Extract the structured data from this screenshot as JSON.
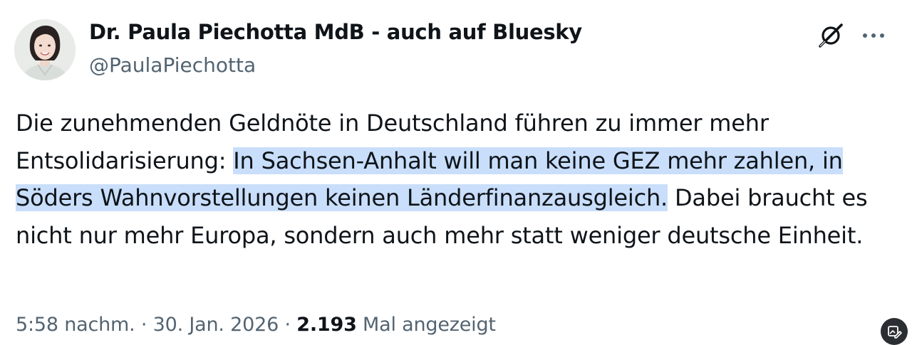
{
  "author": {
    "display_name": "Dr. Paula Piechotta MdB - auch auf Bluesky",
    "handle": "@PaulaPiechotta"
  },
  "icons": {
    "grok": "grok-icon",
    "more": "more-options-icon",
    "floating": "edit-image-icon"
  },
  "tweet": {
    "text_before": "Die zunehmenden Geldnöte in Deutschland führen zu immer mehr Entsolidarisierung: ",
    "text_highlighted": "In Sachsen-Anhalt will man keine GEZ mehr zahlen, in Söders Wahnvorstellungen keinen Länderfinanzausgleich.",
    "text_after": " Dabei braucht es nicht nur mehr Europa, sondern auch mehr statt weniger deutsche Einheit."
  },
  "meta": {
    "time": "5:58 nachm.",
    "separator": " · ",
    "date": "30. Jan. 2026",
    "views_count": "2.193",
    "views_label": " Mal angezeigt"
  },
  "colors": {
    "text": "#0f1419",
    "secondary": "#536471",
    "highlight": "#c9defa"
  }
}
